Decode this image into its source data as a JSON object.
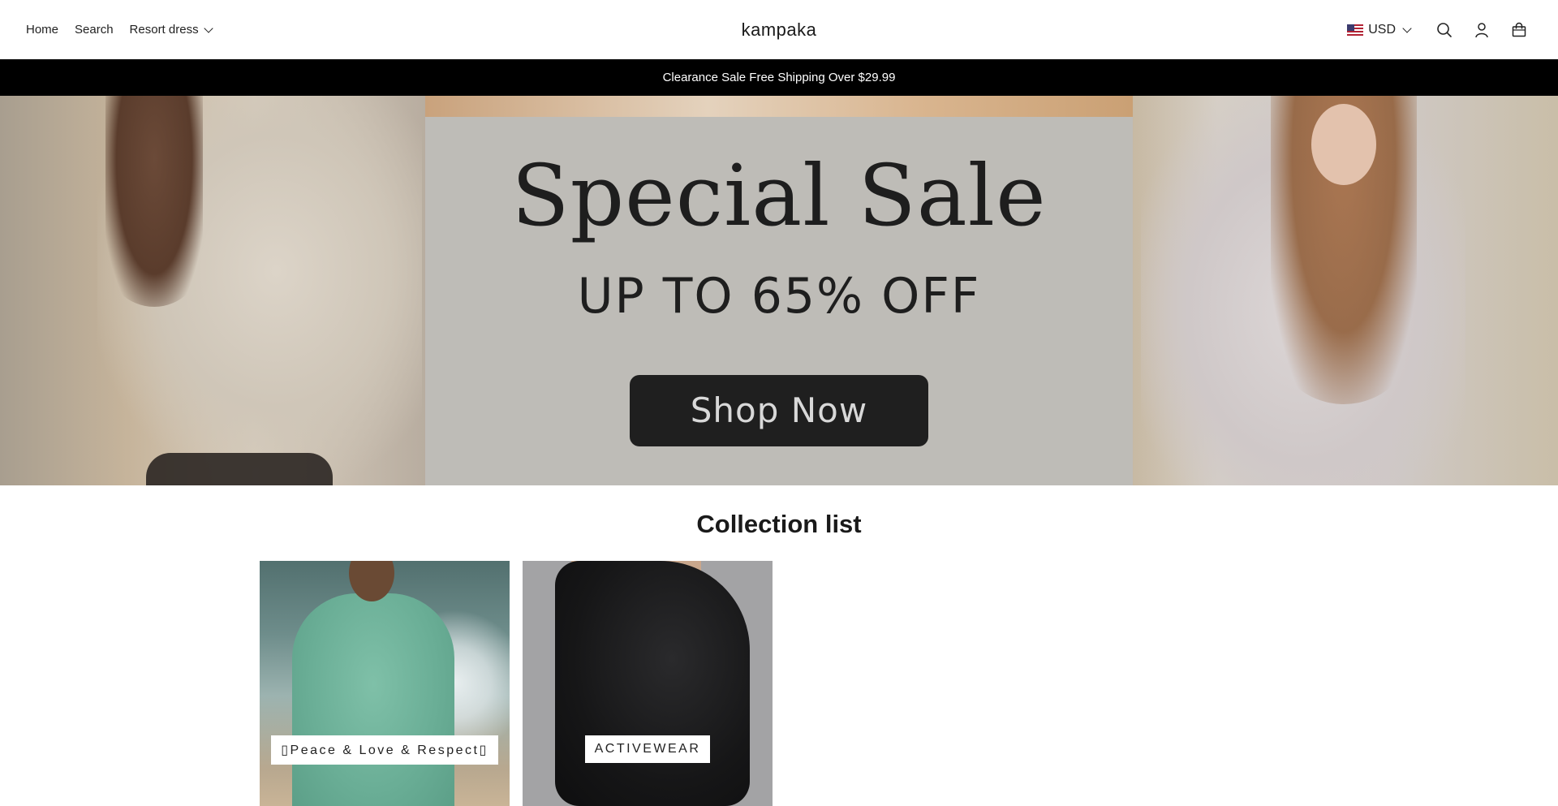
{
  "header": {
    "nav": [
      {
        "label": "Home"
      },
      {
        "label": "Search"
      },
      {
        "label": "Resort dress"
      }
    ],
    "brand": "kampaka",
    "currency": "USD"
  },
  "announcement": "Clearance Sale Free Shipping Over $29.99",
  "hero": {
    "title": "Special Sale",
    "subtitle": "UP TO 65% OFF",
    "button": "Shop Now"
  },
  "collection": {
    "title": "Collection list",
    "items": [
      {
        "label": "▯Peace & Love & Respect▯"
      },
      {
        "label": "ACTIVEWEAR"
      }
    ]
  },
  "colors": {
    "announcement_bg": "#000000",
    "hero_panel": "#bebcb7",
    "button_bg": "#1f1f1f"
  },
  "icons": [
    "us-flag-icon",
    "chevron-down-icon",
    "search-icon",
    "account-icon",
    "cart-icon"
  ]
}
